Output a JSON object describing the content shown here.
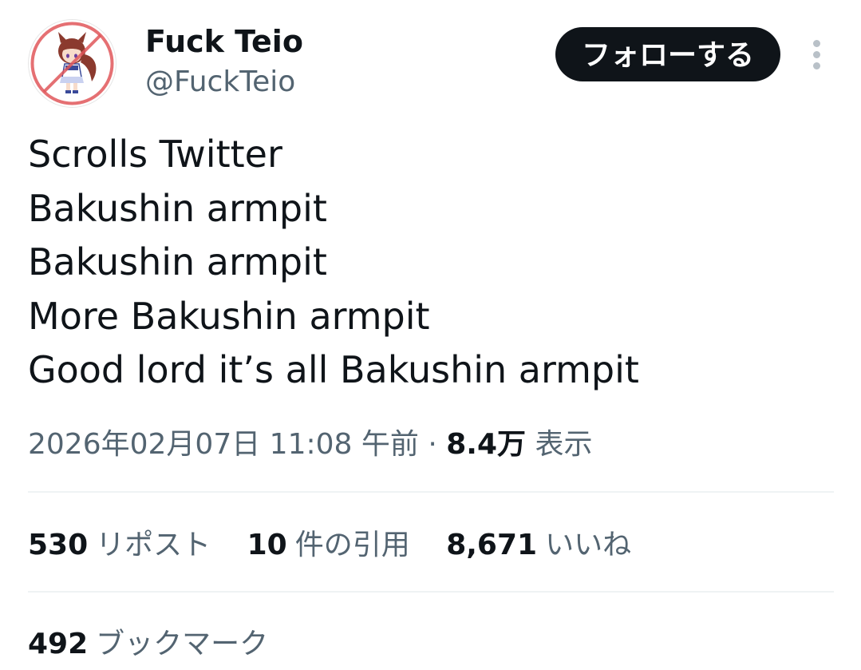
{
  "author": {
    "display_name": "Fuck Teio",
    "handle": "@FuckTeio"
  },
  "actions": {
    "follow_label": "フォローする"
  },
  "tweet": {
    "lines": [
      "Scrolls Twitter",
      "Bakushin armpit",
      "Bakushin armpit",
      "More Bakushin armpit",
      "Good lord it’s all Bakushin armpit"
    ]
  },
  "meta": {
    "timestamp": "2026年02月07日 11:08 午前",
    "separator": "·",
    "views_count": "8.4万",
    "views_label": "表示"
  },
  "stats": {
    "reposts_count": "530",
    "reposts_label": "リポスト",
    "quotes_count": "10",
    "quotes_label": "件の引用",
    "likes_count": "8,671",
    "likes_label": "いいね",
    "bookmarks_count": "492",
    "bookmarks_label": "ブックマーク"
  },
  "icons": {
    "more": "more-vertical-icon",
    "avatar": "avatar-prohibition-sign"
  },
  "colors": {
    "text_primary": "#0f1419",
    "text_secondary": "#536471",
    "button_bg": "#0f1419",
    "divider": "#eff3f4",
    "prohibition_red": "#e0575b"
  }
}
